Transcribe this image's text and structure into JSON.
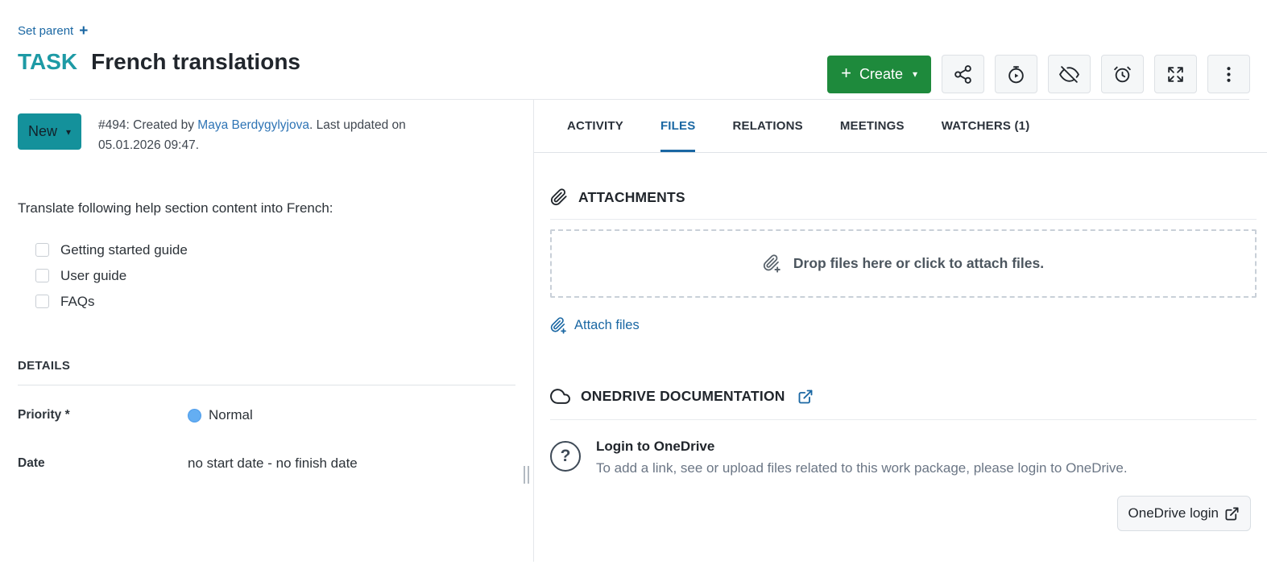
{
  "header": {
    "set_parent_label": "Set parent",
    "type_label": "TASK",
    "title": "French translations"
  },
  "toolbar": {
    "create_label": "Create",
    "icon_buttons": [
      "share",
      "start-timer",
      "unwatch",
      "set-reminder",
      "fullscreen",
      "more"
    ]
  },
  "status": {
    "name": "New",
    "meta_prefix": "#494: Created by ",
    "author": "Maya Berdygylyjova",
    "meta_suffix": ". Last updated on 05.01.2026 09:47."
  },
  "description": {
    "intro": "Translate following help section content into French:",
    "checklist": [
      {
        "label": "Getting started guide",
        "checked": false
      },
      {
        "label": "User guide",
        "checked": false
      },
      {
        "label": "FAQs",
        "checked": false
      }
    ]
  },
  "details": {
    "heading": "DETAILS",
    "priority_label": "Priority *",
    "priority_value": "Normal",
    "date_label": "Date",
    "date_value": "no start date - no finish date"
  },
  "tabs": [
    {
      "label": "ACTIVITY",
      "active": false
    },
    {
      "label": "FILES",
      "active": true
    },
    {
      "label": "RELATIONS",
      "active": false
    },
    {
      "label": "MEETINGS",
      "active": false
    },
    {
      "label": "WATCHERS (1)",
      "active": false
    }
  ],
  "files_tab": {
    "attachments_heading": "ATTACHMENTS",
    "dropzone_text": "Drop files here or click to attach files.",
    "attach_files_label": "Attach files",
    "onedrive_heading": "ONEDRIVE DOCUMENTATION",
    "login_title": "Login to OneDrive",
    "login_description": "To add a link, see or upload files related to this work package, please login to OneDrive.",
    "login_button_label": "OneDrive login"
  },
  "colors": {
    "link_blue": "#1A67A3",
    "type_teal": "#1D9AA5",
    "status_teal": "#14919B",
    "create_green": "#1E8A3C",
    "tab_active_blue": "#1A67A3",
    "priority_dot_blue": "#64AEF2"
  }
}
